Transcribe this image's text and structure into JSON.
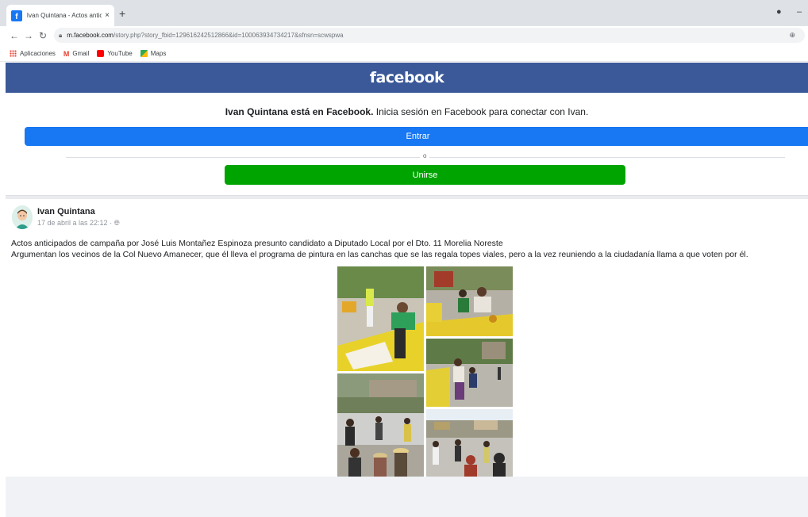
{
  "browser": {
    "tab_title": "Ivan Quintana - Actos anticipado",
    "tab_close": "×",
    "new_tab": "+",
    "url_domain": "m.facebook.com",
    "url_path": "/story.php?story_fbid=129616242512866&id=100063934734217&sfnsn=scwspwa",
    "bookmarks": [
      "Aplicaciones",
      "Gmail",
      "YouTube",
      "Maps"
    ]
  },
  "header": {
    "logo": "facebook"
  },
  "login": {
    "message_bold": "Ivan Quintana está en Facebook.",
    "message_rest": " Inicia sesión en Facebook para conectar con Ivan.",
    "login_label": "Entrar",
    "or_label": "o",
    "signup_label": "Unirse"
  },
  "post": {
    "author": "Ivan Quintana",
    "timestamp": "17 de abril a las 22:12 · ",
    "text_line1": "Actos anticipados de campaña por José Luis Montañez Espinoza presunto candidato a Diputado Local por el Dto. 11 Morelia Noreste",
    "text_line2": "Argumentan los vecinos de la Col Nuevo Amanecer, que él lleva el programa de pintura en las canchas que se las regala topes viales, pero a la vez reuniendo a la ciudadanía llama a que voten por él."
  },
  "colors": {
    "fb_header": "#3b5998",
    "login_button": "#1877f2",
    "signup_button": "#00a400"
  }
}
